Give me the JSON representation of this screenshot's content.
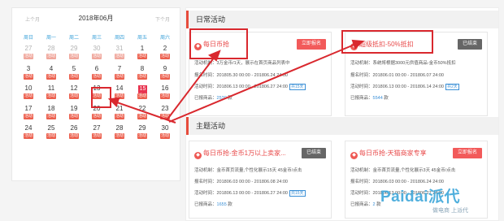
{
  "calendar": {
    "prev_label": "上个月",
    "title": "2018年06月",
    "next_label": "下个月",
    "weekdays": [
      "周日",
      "周一",
      "周二",
      "周三",
      "周四",
      "周五",
      "周六"
    ],
    "tag_label": "活动",
    "weeks": [
      [
        {
          "d": "27",
          "tag": true,
          "dim": true
        },
        {
          "d": "28",
          "tag": true,
          "dim": true
        },
        {
          "d": "29",
          "tag": true,
          "dim": true
        },
        {
          "d": "30",
          "tag": true,
          "dim": true
        },
        {
          "d": "31",
          "tag": true,
          "dim": true
        },
        {
          "d": "1",
          "tag": true
        },
        {
          "d": "2",
          "tag": true
        }
      ],
      [
        {
          "d": "3",
          "tag": true
        },
        {
          "d": "4",
          "tag": true
        },
        {
          "d": "5",
          "tag": true
        },
        {
          "d": "6",
          "tag": true
        },
        {
          "d": "7",
          "tag": true
        },
        {
          "d": "8",
          "tag": true
        },
        {
          "d": "9",
          "tag": true
        }
      ],
      [
        {
          "d": "10",
          "tag": true
        },
        {
          "d": "11",
          "tag": true
        },
        {
          "d": "12",
          "tag": true
        },
        {
          "d": "13",
          "tag": true
        },
        {
          "d": "14",
          "tag": true
        },
        {
          "d": "15",
          "tag": true
        },
        {
          "d": "16",
          "tag": true
        }
      ],
      [
        {
          "d": "17",
          "tag": true
        },
        {
          "d": "18",
          "tag": true
        },
        {
          "d": "19",
          "tag": true
        },
        {
          "d": "20",
          "tag": true
        },
        {
          "d": "21",
          "tag": true
        },
        {
          "d": "22",
          "tag": true
        },
        {
          "d": "23",
          "tag": true
        }
      ],
      [
        {
          "d": "24",
          "tag": true
        },
        {
          "d": "25",
          "tag": true
        },
        {
          "d": "26",
          "tag": true
        },
        {
          "d": "27",
          "tag": true
        },
        {
          "d": "28",
          "tag": true
        },
        {
          "d": "29",
          "tag": true
        },
        {
          "d": "30",
          "tag": true
        }
      ]
    ],
    "today_label": "15"
  },
  "sections": {
    "daily": "日常活动",
    "theme": "主题活动"
  },
  "cards": [
    {
      "title": "每日币抢",
      "btn": "立即报名",
      "btn_style": "red",
      "mechanism": "活动机制：3万金币/1天，展示在首页商品列表中",
      "signup": "报名时间：201805.30 00:00 - 201806.24 24:00",
      "period": "活动时间：201806.13 00:00 - 201806.27 24:00",
      "badge": "共15天",
      "signed": "已报商品：",
      "signed_count": "2530",
      "signed_unit": "款"
    },
    {
      "title": "超级抵扣-50%抵扣",
      "btn": "已结束",
      "btn_style": "gray",
      "mechanism": "活动机制：系统将根据3000元供值商品-金币50%抵扣",
      "signup": "报名时间：201806.01 00:00 - 201806.07 24:00",
      "period": "活动时间：201806.13 00:00 - 201806.14 24:00",
      "badge": "共2天",
      "signed": "已报商品：",
      "signed_count": "5544",
      "signed_unit": "款"
    },
    {
      "title": "每日币抢-金币1万以上卖家...",
      "btn": "已结束",
      "btn_style": "gray",
      "mechanism": "活动机制：金币首页流量,个性化展示15天 45金币/点击",
      "signup": "报名时间：201806.03 00:00 - 201806.08 24:00",
      "period": "活动时间：201806.13 00:00 - 201806.27 24:00",
      "badge": "共15天",
      "signed": "已报商品：",
      "signed_count": "1655",
      "signed_unit": "款"
    },
    {
      "title": "每日币抢-天猫商家专享",
      "btn": "立即报名",
      "btn_style": "red",
      "mechanism": "活动机制：金币首页流量,个性化展示3天 45金币/点击",
      "signup": "报名时间：201806.03 00:00 - 201806.24 24:00",
      "period": "活动时间：201806.13 00:00 - 201806.27 24:00",
      "badge": "",
      "signed": "已报商品：",
      "signed_count": "2",
      "signed_unit": "款"
    }
  ],
  "watermark": {
    "main": "Paidai派代",
    "sub": "做电商 上派代"
  },
  "colors": {
    "accent_red": "#e84a4a",
    "button_red": "#f25a5a",
    "button_gray": "#666666",
    "link_blue": "#3a8fd6",
    "annotation_red": "#d9282e",
    "watermark_blue": "#39a5d9"
  }
}
